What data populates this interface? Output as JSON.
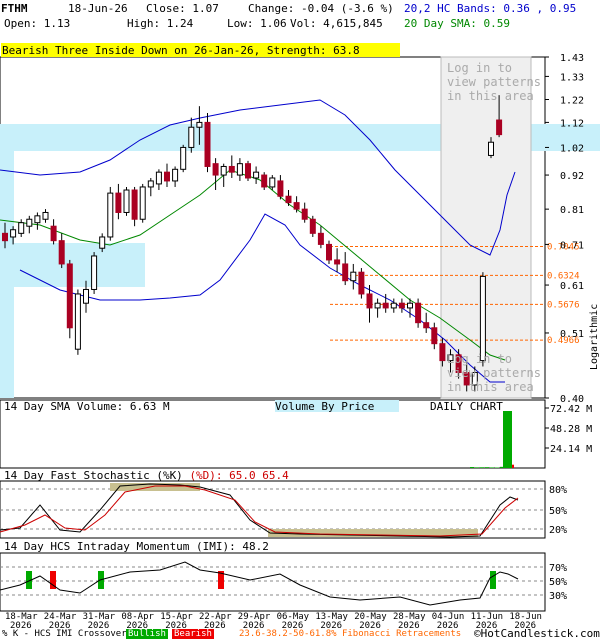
{
  "header": {
    "ticker": "FTHM",
    "date": "18-Jun-26",
    "close": "Close: 1.07",
    "change": "Change: -0.04 (-3.6 %)",
    "open": "Open: 1.13",
    "high": "High: 1.24",
    "low": "Low: 1.06",
    "vol": "Vol: 4,615,845",
    "bands": "20,2 HC Bands: 0.36 , 0.95",
    "sma": "20 Day SMA: 0.59"
  },
  "pattern_banner": "Bearish Three Inside Down on 26-Jan-26, Strength: 63.8",
  "login_text_top": [
    "Log in to",
    "view patterns",
    "in this area"
  ],
  "login_text_bottom": [
    "Log in to",
    "view patterns",
    "in this area"
  ],
  "price_axis_label": "Logarithmic",
  "fib_labels": [
    "0.7045",
    "0.6324",
    "0.5676",
    "0.4966"
  ],
  "volume_panel": {
    "title": "14 Day SMA Volume: 6.63 M",
    "vbp": "Volume By Price",
    "daily": "DAILY CHART",
    "ticks": [
      "72.42 M",
      "48.28 M",
      "24.14 M"
    ]
  },
  "stoch_panel": {
    "title_a": "14 Day Fast Stochastic (%K)",
    "title_b": "(%D): 65.0",
    "title_c": "65.4",
    "ticks": [
      "80%",
      "50%",
      "20%"
    ]
  },
  "imi_panel": {
    "title": "14 Day HCS Intraday Momentum (IMI): 48.2",
    "ticks": [
      "70%",
      "50%",
      "30%"
    ]
  },
  "x_labels": [
    {
      "d": "18-Mar",
      "y": "2026"
    },
    {
      "d": "24-Mar",
      "y": "2026"
    },
    {
      "d": "31-Mar",
      "y": "2026"
    },
    {
      "d": "08-Apr",
      "y": "2026"
    },
    {
      "d": "15-Apr",
      "y": "2026"
    },
    {
      "d": "22-Apr",
      "y": "2026"
    },
    {
      "d": "29-Apr",
      "y": "2026"
    },
    {
      "d": "06-May",
      "y": "2026"
    },
    {
      "d": "13-May",
      "y": "2026"
    },
    {
      "d": "20-May",
      "y": "2026"
    },
    {
      "d": "28-May",
      "y": "2026"
    },
    {
      "d": "04-Jun",
      "y": "2026"
    },
    {
      "d": "11-Jun",
      "y": "2026"
    },
    {
      "d": "18-Jun",
      "y": "2026"
    }
  ],
  "footer": {
    "legend": "% K - HCS IMI Crossover:",
    "bullish": "Bullish",
    "bearish": "Bearish",
    "fib": "23.6-38.2-50-61.8% Fibonacci Retracements",
    "copyright": "©HotCandlestick.com"
  },
  "colors": {
    "bullish": "#00aa00",
    "bearish": "#ee0000",
    "band": "#0000cc",
    "sma": "#008800",
    "fib": "#ff6600",
    "zone": "#c8f0fa"
  },
  "chart_data": {
    "type": "candlestick",
    "y_scale": "log",
    "ylim": [
      0.4,
      1.43
    ],
    "y_ticks": [
      1.43,
      1.33,
      1.22,
      1.12,
      1.02,
      0.92,
      0.81,
      0.71,
      0.61,
      0.51,
      0.4
    ],
    "fib_levels": [
      0.7045,
      0.6324,
      0.5676,
      0.4966
    ],
    "candles": [
      {
        "o": 0.74,
        "h": 0.77,
        "l": 0.7,
        "c": 0.72
      },
      {
        "o": 0.73,
        "h": 0.76,
        "l": 0.71,
        "c": 0.75
      },
      {
        "o": 0.74,
        "h": 0.78,
        "l": 0.73,
        "c": 0.77
      },
      {
        "o": 0.76,
        "h": 0.79,
        "l": 0.74,
        "c": 0.78
      },
      {
        "o": 0.77,
        "h": 0.8,
        "l": 0.75,
        "c": 0.79
      },
      {
        "o": 0.78,
        "h": 0.81,
        "l": 0.77,
        "c": 0.8
      },
      {
        "o": 0.76,
        "h": 0.78,
        "l": 0.71,
        "c": 0.72
      },
      {
        "o": 0.72,
        "h": 0.74,
        "l": 0.65,
        "c": 0.66
      },
      {
        "o": 0.66,
        "h": 0.67,
        "l": 0.5,
        "c": 0.52
      },
      {
        "o": 0.48,
        "h": 0.6,
        "l": 0.47,
        "c": 0.59
      },
      {
        "o": 0.57,
        "h": 0.62,
        "l": 0.55,
        "c": 0.6
      },
      {
        "o": 0.6,
        "h": 0.69,
        "l": 0.59,
        "c": 0.68
      },
      {
        "o": 0.7,
        "h": 0.74,
        "l": 0.69,
        "c": 0.73
      },
      {
        "o": 0.73,
        "h": 0.88,
        "l": 0.72,
        "c": 0.86
      },
      {
        "o": 0.86,
        "h": 0.89,
        "l": 0.78,
        "c": 0.8
      },
      {
        "o": 0.8,
        "h": 0.88,
        "l": 0.79,
        "c": 0.87
      },
      {
        "o": 0.87,
        "h": 0.88,
        "l": 0.76,
        "c": 0.78
      },
      {
        "o": 0.78,
        "h": 0.89,
        "l": 0.77,
        "c": 0.88
      },
      {
        "o": 0.88,
        "h": 0.91,
        "l": 0.85,
        "c": 0.9
      },
      {
        "o": 0.89,
        "h": 0.94,
        "l": 0.87,
        "c": 0.93
      },
      {
        "o": 0.93,
        "h": 0.96,
        "l": 0.88,
        "c": 0.9
      },
      {
        "o": 0.9,
        "h": 0.95,
        "l": 0.88,
        "c": 0.94
      },
      {
        "o": 0.94,
        "h": 1.03,
        "l": 0.93,
        "c": 1.02
      },
      {
        "o": 1.02,
        "h": 1.14,
        "l": 1.0,
        "c": 1.1
      },
      {
        "o": 1.1,
        "h": 1.19,
        "l": 1.03,
        "c": 1.12
      },
      {
        "o": 1.12,
        "h": 1.16,
        "l": 0.93,
        "c": 0.95
      },
      {
        "o": 0.96,
        "h": 0.98,
        "l": 0.87,
        "c": 0.92
      },
      {
        "o": 0.92,
        "h": 0.96,
        "l": 0.88,
        "c": 0.95
      },
      {
        "o": 0.95,
        "h": 0.99,
        "l": 0.91,
        "c": 0.93
      },
      {
        "o": 0.92,
        "h": 0.98,
        "l": 0.9,
        "c": 0.96
      },
      {
        "o": 0.96,
        "h": 0.97,
        "l": 0.9,
        "c": 0.91
      },
      {
        "o": 0.91,
        "h": 0.95,
        "l": 0.89,
        "c": 0.93
      },
      {
        "o": 0.92,
        "h": 0.93,
        "l": 0.87,
        "c": 0.88
      },
      {
        "o": 0.88,
        "h": 0.92,
        "l": 0.87,
        "c": 0.91
      },
      {
        "o": 0.9,
        "h": 0.92,
        "l": 0.84,
        "c": 0.85
      },
      {
        "o": 0.85,
        "h": 0.87,
        "l": 0.82,
        "c": 0.83
      },
      {
        "o": 0.83,
        "h": 0.85,
        "l": 0.8,
        "c": 0.81
      },
      {
        "o": 0.81,
        "h": 0.83,
        "l": 0.77,
        "c": 0.78
      },
      {
        "o": 0.78,
        "h": 0.79,
        "l": 0.73,
        "c": 0.74
      },
      {
        "o": 0.74,
        "h": 0.76,
        "l": 0.7,
        "c": 0.71
      },
      {
        "o": 0.71,
        "h": 0.72,
        "l": 0.66,
        "c": 0.67
      },
      {
        "o": 0.67,
        "h": 0.7,
        "l": 0.64,
        "c": 0.66
      },
      {
        "o": 0.66,
        "h": 0.69,
        "l": 0.61,
        "c": 0.62
      },
      {
        "o": 0.62,
        "h": 0.66,
        "l": 0.6,
        "c": 0.64
      },
      {
        "o": 0.64,
        "h": 0.65,
        "l": 0.58,
        "c": 0.59
      },
      {
        "o": 0.59,
        "h": 0.61,
        "l": 0.53,
        "c": 0.56
      },
      {
        "o": 0.56,
        "h": 0.58,
        "l": 0.54,
        "c": 0.57
      },
      {
        "o": 0.57,
        "h": 0.59,
        "l": 0.55,
        "c": 0.56
      },
      {
        "o": 0.56,
        "h": 0.58,
        "l": 0.55,
        "c": 0.57
      },
      {
        "o": 0.57,
        "h": 0.58,
        "l": 0.55,
        "c": 0.56
      },
      {
        "o": 0.56,
        "h": 0.58,
        "l": 0.54,
        "c": 0.57
      },
      {
        "o": 0.57,
        "h": 0.58,
        "l": 0.52,
        "c": 0.53
      },
      {
        "o": 0.53,
        "h": 0.55,
        "l": 0.51,
        "c": 0.52
      },
      {
        "o": 0.52,
        "h": 0.53,
        "l": 0.48,
        "c": 0.49
      },
      {
        "o": 0.49,
        "h": 0.5,
        "l": 0.45,
        "c": 0.46
      },
      {
        "o": 0.46,
        "h": 0.48,
        "l": 0.44,
        "c": 0.47
      },
      {
        "o": 0.47,
        "h": 0.48,
        "l": 0.43,
        "c": 0.44
      },
      {
        "o": 0.44,
        "h": 0.46,
        "l": 0.41,
        "c": 0.42
      },
      {
        "o": 0.42,
        "h": 0.45,
        "l": 0.41,
        "c": 0.44
      },
      {
        "o": 0.46,
        "h": 0.64,
        "l": 0.45,
        "c": 0.63
      },
      {
        "o": 0.99,
        "h": 1.06,
        "l": 0.98,
        "c": 1.04
      },
      {
        "o": 1.13,
        "h": 1.24,
        "l": 1.06,
        "c": 1.07
      }
    ],
    "volume_scale_max": 72.42,
    "volume_values": [
      1.2,
      0.8,
      0.9,
      1.0,
      0.7,
      0.6,
      1.4,
      8.5,
      4.0
    ],
    "stoch_k_last": 65.0,
    "stoch_d_last": 65.4,
    "imi_last": 48.2
  }
}
